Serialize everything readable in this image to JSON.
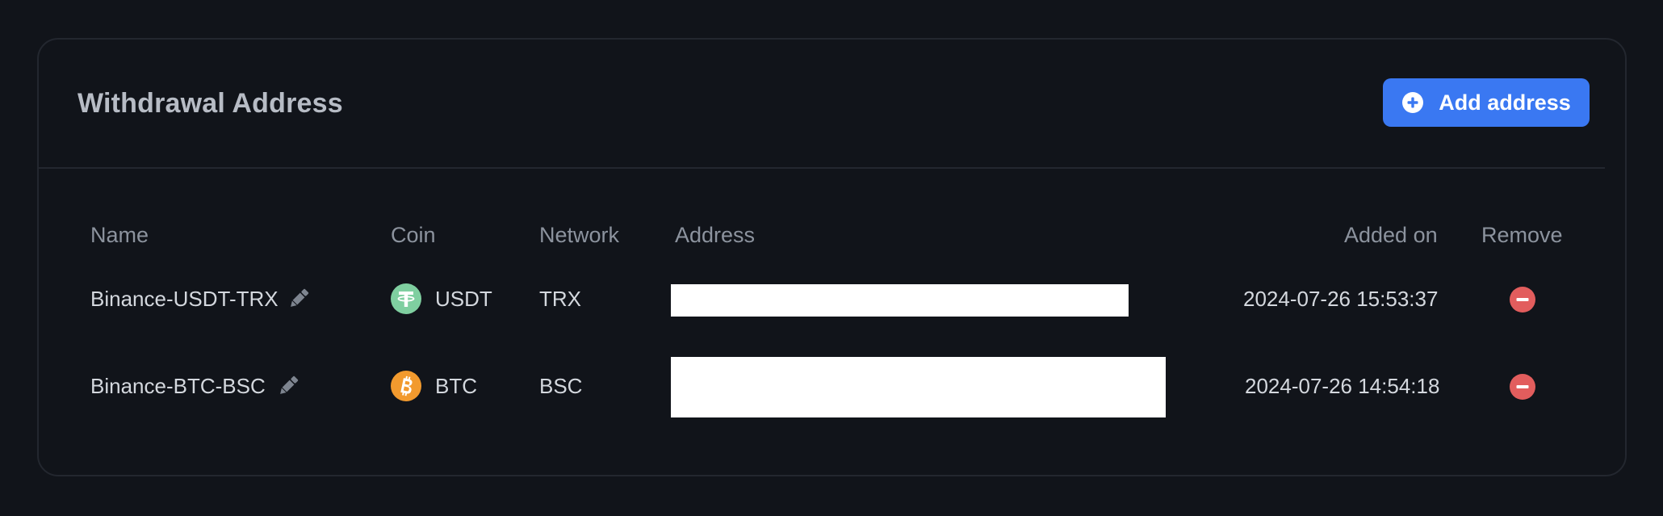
{
  "card": {
    "title": "Withdrawal Address",
    "add_button_label": "Add address"
  },
  "table": {
    "headers": {
      "name": "Name",
      "coin": "Coin",
      "network": "Network",
      "address": "Address",
      "added_on": "Added on",
      "remove": "Remove"
    },
    "rows": [
      {
        "name": "Binance-USDT-TRX",
        "coin": "USDT",
        "coin_icon": "tether-icon",
        "network": "TRX",
        "address": "",
        "added_on": "2024-07-26 15:53:37"
      },
      {
        "name": "Binance-BTC-BSC",
        "coin": "BTC",
        "coin_icon": "bitcoin-icon",
        "network": "BSC",
        "address": "",
        "added_on": "2024-07-26 14:54:18"
      }
    ]
  },
  "colors": {
    "background": "#11141a",
    "accent": "#3a78f2",
    "remove": "#e25d5d",
    "tether": "#7fcfa0",
    "bitcoin": "#f29a2e"
  },
  "icons": {
    "add": "plus-circle-icon",
    "edit": "pencil-icon",
    "remove": "minus-circle-icon"
  }
}
